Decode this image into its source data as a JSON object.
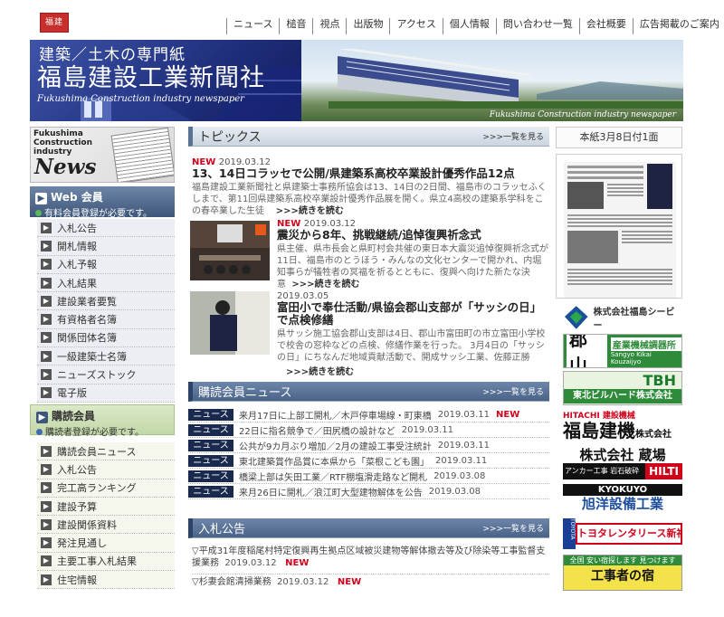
{
  "logo": {
    "text": "福建"
  },
  "nav": [
    "ニュース",
    "槌音",
    "視点",
    "出版物",
    "アクセス",
    "個人情報",
    "問い合わせ一覧",
    "会社概要",
    "広告掲載のご案内"
  ],
  "banner": {
    "subtitle": "建築／土木の専門紙",
    "title": "福島建設工業新聞社",
    "en": "Fukushima Construction industry newspaper",
    "en_right": "Fukushima Construction industry newspaper"
  },
  "newslogo": {
    "line1": "Fukushima",
    "line2": "Construction",
    "line3": "industry",
    "word": "News"
  },
  "web": {
    "title": "Web 会員",
    "note": "有料会員登録が必要です。",
    "items": [
      "入札公告",
      "開札情報",
      "入札予報",
      "入札結果",
      "建設業者要覧",
      "有資格者名簿",
      "関係団体名簿",
      "一級建築士名簿",
      "ニューズストック",
      "電子版"
    ]
  },
  "subscriber": {
    "title": "購読会員",
    "note": "購読者登録が必要です。",
    "items": [
      "購読会員ニュース",
      "入札公告",
      "完工高ランキング",
      "建設予算",
      "建設関係資料",
      "発注見通し",
      "主要工事入札結果",
      "住宅情報"
    ]
  },
  "topics": {
    "title": "トピックス",
    "more": ">>>一覧を見る",
    "items": [
      {
        "new": "NEW",
        "date": "2019.03.12",
        "headline": "13、14日コラッセで公開/県建築系高校卒業設計優秀作品12点",
        "body": "福島建設工業新聞社と県建築士事務所協会は13、14日の2日間、福島市のコラッセふくしまで、第11回県建築系高校卒業設計優秀作品展を開く。県立4高校の建築系学科をこの春卒業した生徒",
        "readmore": ">>>続きを読む"
      },
      {
        "new": "NEW",
        "date": "2019.03.12",
        "headline": "震災から8年、挑戦継続/追悼復興祈念式",
        "body": "県主催、県市長会と県町村会共催の東日本大震災追悼復興祈念式が11日、福島市のとうほう・みんなの文化センターで開かれ、内堀知事らが犠牲者の冥福を祈るとともに、復興へ向けた新たな決意",
        "readmore": ">>>続きを読む"
      },
      {
        "new": "",
        "date": "2019.03.05",
        "headline": "富田小で奉仕活動/県協会郡山支部が「サッシの日」で点検修繕",
        "body": "県サッシ施工協会郡山支部は4日、郡山市富田町の市立富田小学校で校舎の窓枠などの点検、修繕作業を行った。 3月4日の「サッシの日」にちなんだ地域貢献活動で、開成サッシ工業、佐藤正勝",
        "readmore": ">>>続きを読む"
      }
    ]
  },
  "subnews": {
    "title": "購読会員ニュース",
    "more": ">>>一覧を見る",
    "tag": "ニュース",
    "items": [
      {
        "text": "来月17日に上部工開札／木戸停車場線・町東橋",
        "date": "2019.03.11",
        "new": "NEW"
      },
      {
        "text": "22日に指名競争で／田尻橋の設計など",
        "date": "2019.03.11",
        "new": ""
      },
      {
        "text": "公共が9カ月ぶり増加／2月の建設工事受注統計",
        "date": "2019.03.11",
        "new": ""
      },
      {
        "text": "東北建築賞作品賞に本県から「菜根こども園」",
        "date": "2019.03.11",
        "new": ""
      },
      {
        "text": "橋梁上部は矢田工業／RTF棚塩滑走路など開札",
        "date": "2019.03.08",
        "new": ""
      },
      {
        "text": "来月26日に開札／浪江町大型建物解体を公告",
        "date": "2019.03.08",
        "new": ""
      }
    ]
  },
  "bids": {
    "title": "入札公告",
    "more": ">>>一覧を見る",
    "items": [
      {
        "text": "▽平成31年度稲尾村特定復興再生拠点区域被災建物等解体撤去等及び除染等工事監督支援業務",
        "date": "2019.03.12",
        "new": "NEW"
      },
      {
        "text": "▽杉妻会館清掃業務",
        "date": "2019.03.12",
        "new": "NEW"
      }
    ]
  },
  "issue": {
    "label": "本紙3月8日付1面"
  },
  "ads": [
    {
      "name": "株式会社福島シービー"
    },
    {
      "big": "郡山",
      "sub": "産業機械調器所",
      "en": "Sangyo Kikai Kouzaijyo"
    },
    {
      "big": "TBH",
      "sub": "東北ビルハード株式会社"
    },
    {
      "top": "HITACHI 建設機械",
      "big": "福島建機",
      "tail": "株式会社"
    },
    {
      "big": "株式会社 蔵場",
      "sub": "アンカー工事 岩石破砕工事",
      "brand": "HILTI"
    },
    {
      "top": "KYOKUYO",
      "big": "旭洋設備工業"
    },
    {
      "top": "TOYOTA",
      "big": "トヨタレンタリース新福島"
    },
    {
      "top": "全国 安い宿探します 見つけます",
      "big": "工事者の宿"
    }
  ]
}
